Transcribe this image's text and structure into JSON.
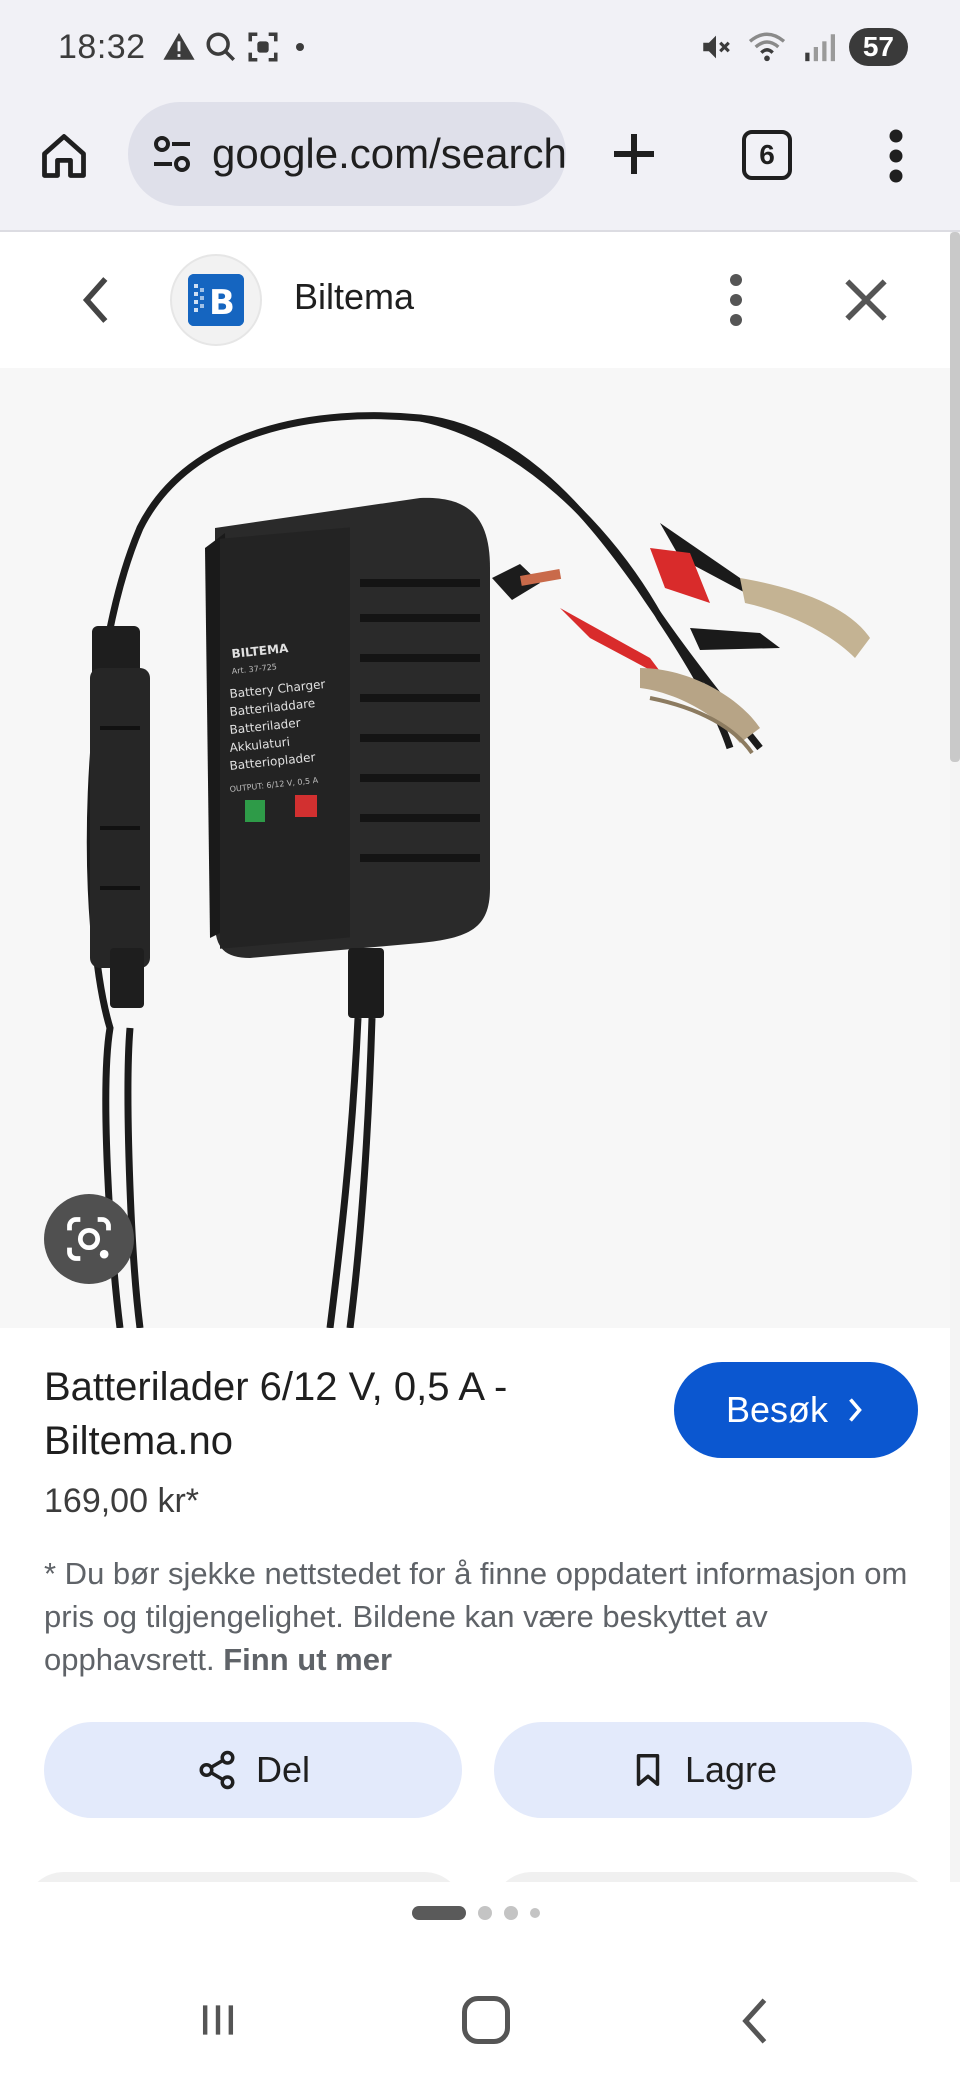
{
  "status_bar": {
    "time": "18:32",
    "icons": [
      "warning-icon",
      "search-icon",
      "screenshot-icon",
      "dot-icon"
    ],
    "right_icons": [
      "mute-icon",
      "wifi-icon",
      "signal-icon"
    ],
    "battery": "57",
    "wifi_band": "5"
  },
  "browser": {
    "url": "google.com/search",
    "tab_count": "6"
  },
  "sheet_header": {
    "site_name": "Biltema",
    "logo_letter": "B"
  },
  "product": {
    "title": "Batterilader 6/12 V, 0,5 A - Biltema.no",
    "price": "169,00 kr*",
    "visit_label": "Besøk",
    "disclaimer_text": "* Du bør sjekke nettstedet for å finne oppdatert informasjon om pris og tilgjengelighet. Bildene kan være beskyttet av opphavsrett.",
    "learn_more": "Finn ut mer",
    "image_label": {
      "brand": "BILTEMA",
      "art": "Art. 37-725",
      "lines": [
        "Battery Charger",
        "Batteriladdare",
        "Batterilader",
        "Akkulaturi",
        "Batterioplader"
      ],
      "output": "OUTPUT: 6/12 V, 0,5 A"
    }
  },
  "actions": {
    "share_label": "Del",
    "save_label": "Lagre"
  },
  "carousel": {
    "pages": 4,
    "active": 0
  },
  "colors": {
    "accent": "#0b57d0",
    "chip_bg": "#e3eafb",
    "toolbar_bg": "#f1f1f6"
  }
}
